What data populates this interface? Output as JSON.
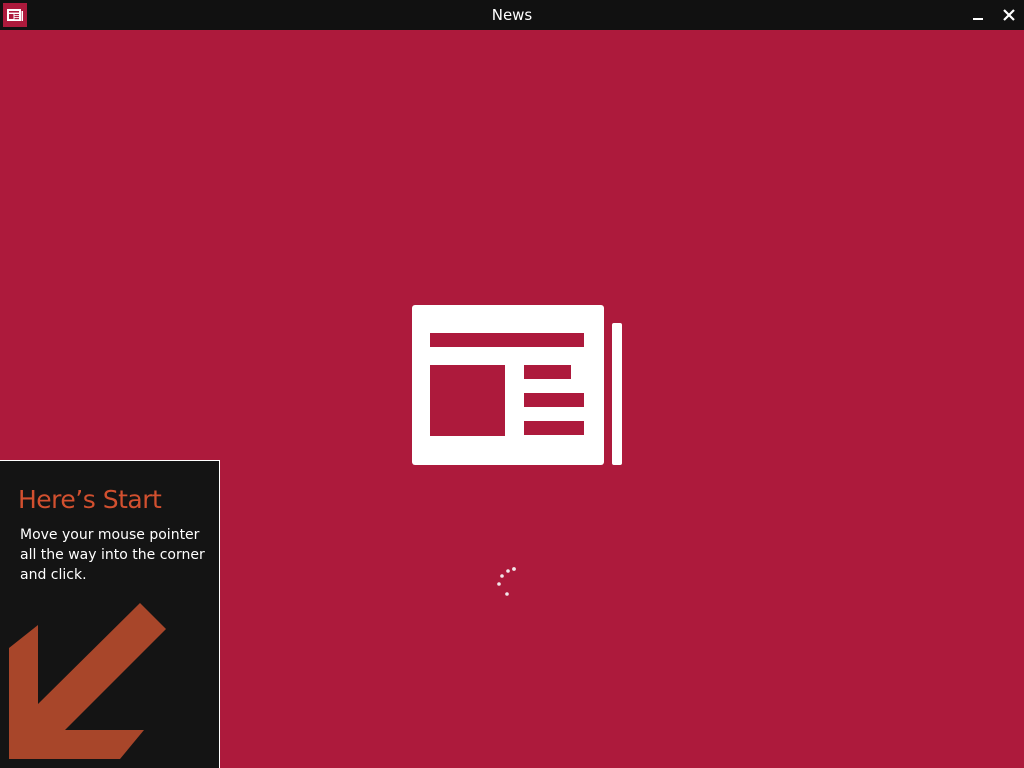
{
  "window": {
    "title": "News",
    "app_icon": "news-app-icon",
    "minimize_icon": "minimize-icon",
    "close_icon": "close-icon"
  },
  "splash": {
    "logo_icon": "newspaper-icon",
    "spinner_icon": "loading-spinner-icon"
  },
  "start_tip": {
    "title": "Here’s Start",
    "body": "Move your mouse pointer all the way into the corner and click.",
    "arrow_icon": "arrow-down-left-icon"
  },
  "colors": {
    "app_background": "#ad1a3c",
    "titlebar": "#111111",
    "tip_background": "#141414",
    "tip_accent": "#d2502f",
    "arrow": "#a8462a"
  }
}
